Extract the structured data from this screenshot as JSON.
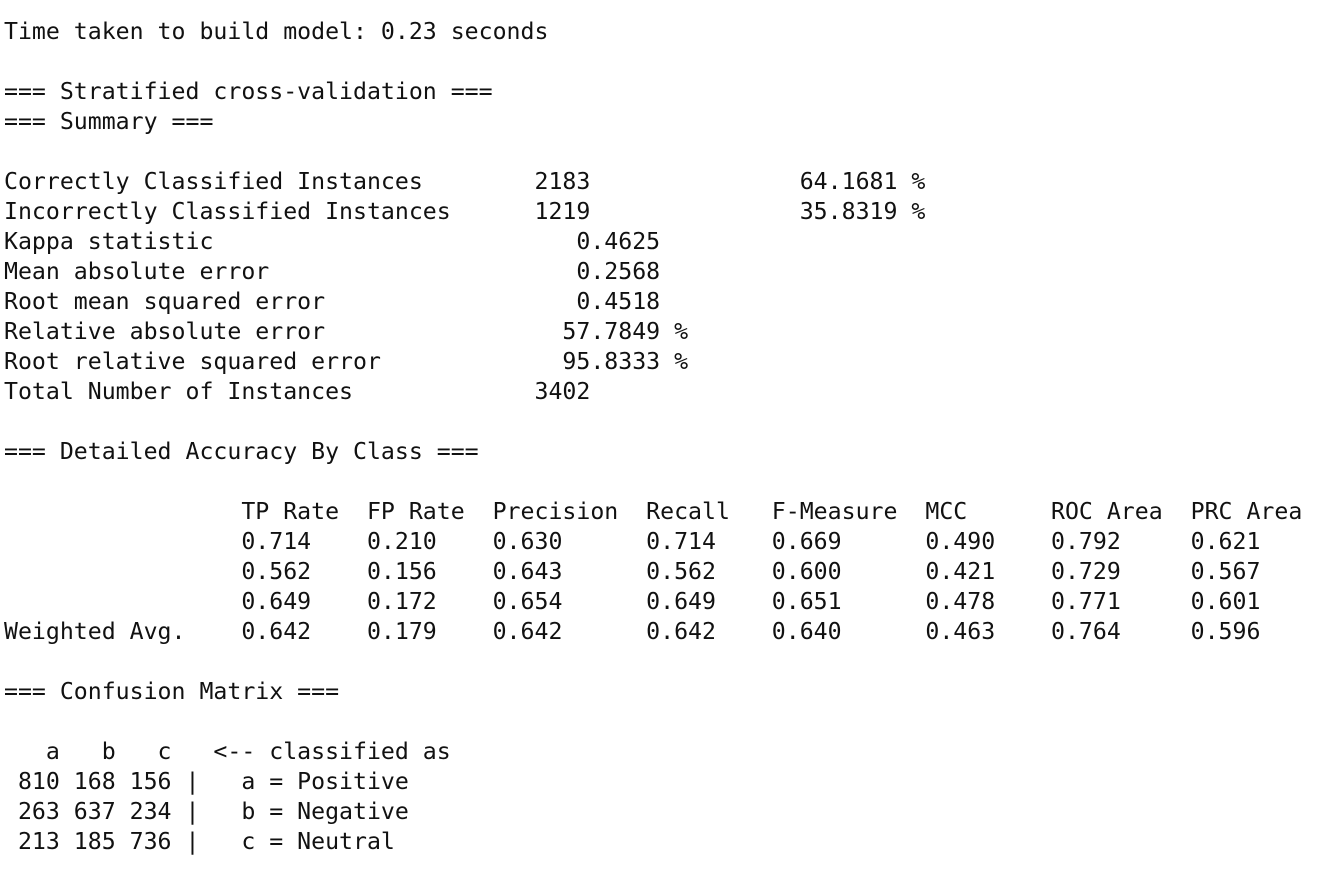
{
  "build_time_line": "Time taken to build model: 0.23 seconds",
  "headers": {
    "cross_validation": "=== Stratified cross-validation ===",
    "summary": "=== Summary ===",
    "detailed_accuracy": "=== Detailed Accuracy By Class ===",
    "confusion_matrix": "=== Confusion Matrix ==="
  },
  "summary_lines": [
    "Correctly Classified Instances        2183               64.1681 %",
    "Incorrectly Classified Instances      1219               35.8319 %",
    "Kappa statistic                          0.4625",
    "Mean absolute error                      0.2568",
    "Root mean squared error                  0.4518",
    "Relative absolute error                 57.7849 %",
    "Root relative squared error             95.8333 %",
    "Total Number of Instances             3402"
  ],
  "accuracy_header_line": "                 TP Rate  FP Rate  Precision  Recall   F-Measure  MCC      ROC Area  PRC Area",
  "accuracy_rows": [
    "                 0.714    0.210    0.630      0.714    0.669      0.490    0.792     0.621",
    "                 0.562    0.156    0.643      0.562    0.600      0.421    0.729     0.567",
    "                 0.649    0.172    0.654      0.649    0.651      0.478    0.771     0.601",
    "Weighted Avg.    0.642    0.179    0.642      0.642    0.640      0.463    0.764     0.596"
  ],
  "confusion_header_line": "   a   b   c   <-- classified as",
  "confusion_rows": [
    " 810 168 156 |   a = Positive",
    " 263 637 234 |   b = Negative",
    " 213 185 736 |   c = Neutral"
  ]
}
